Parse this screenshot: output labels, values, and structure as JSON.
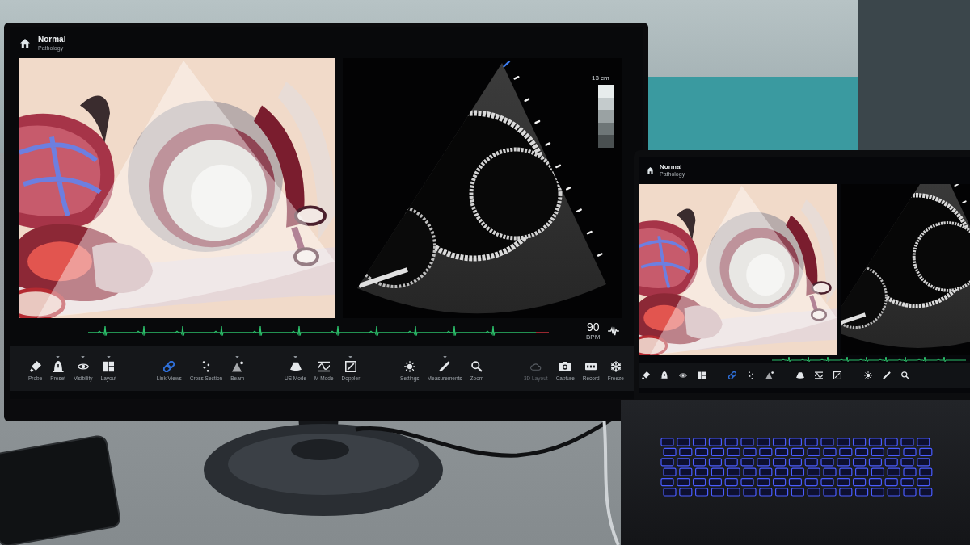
{
  "monitor": {
    "header": {
      "title": "Normal",
      "subtitle": "Pathology"
    },
    "ultrasound": {
      "depth_label": "13 cm"
    },
    "heart_rate": {
      "value": "90",
      "unit": "BPM"
    },
    "toolbar": {
      "groups": [
        {
          "items": [
            {
              "label": "Probe",
              "has_menu": false,
              "selected": false,
              "disabled": false
            },
            {
              "label": "Preset",
              "has_menu": true,
              "selected": false,
              "disabled": false
            },
            {
              "label": "Visibility",
              "has_menu": true,
              "selected": false,
              "disabled": false
            },
            {
              "label": "Layout",
              "has_menu": true,
              "selected": false,
              "disabled": false
            }
          ]
        },
        {
          "items": [
            {
              "label": "Link Views",
              "has_menu": false,
              "selected": true,
              "disabled": false
            },
            {
              "label": "Cross Section",
              "has_menu": false,
              "selected": false,
              "disabled": false
            },
            {
              "label": "Beam",
              "has_menu": true,
              "selected": false,
              "disabled": false
            }
          ]
        },
        {
          "items": [
            {
              "label": "US Mode",
              "has_menu": true,
              "selected": false,
              "disabled": false
            },
            {
              "label": "M Mode",
              "has_menu": false,
              "selected": false,
              "disabled": false
            },
            {
              "label": "Doppler",
              "has_menu": true,
              "selected": false,
              "disabled": false
            }
          ]
        },
        {
          "items": [
            {
              "label": "Settings",
              "has_menu": false,
              "selected": false,
              "disabled": false
            },
            {
              "label": "Measurements",
              "has_menu": true,
              "selected": false,
              "disabled": false
            },
            {
              "label": "Zoom",
              "has_menu": false,
              "selected": false,
              "disabled": false
            }
          ]
        },
        {
          "items": [
            {
              "label": "3D Layout",
              "has_menu": false,
              "selected": false,
              "disabled": true
            },
            {
              "label": "Capture",
              "has_menu": false,
              "selected": false,
              "disabled": false
            },
            {
              "label": "Record",
              "has_menu": false,
              "selected": false,
              "disabled": false
            },
            {
              "label": "Freeze",
              "has_menu": false,
              "selected": false,
              "disabled": false
            }
          ]
        }
      ]
    }
  },
  "laptop": {
    "header": {
      "title": "Normal",
      "subtitle": "Pathology"
    }
  }
}
